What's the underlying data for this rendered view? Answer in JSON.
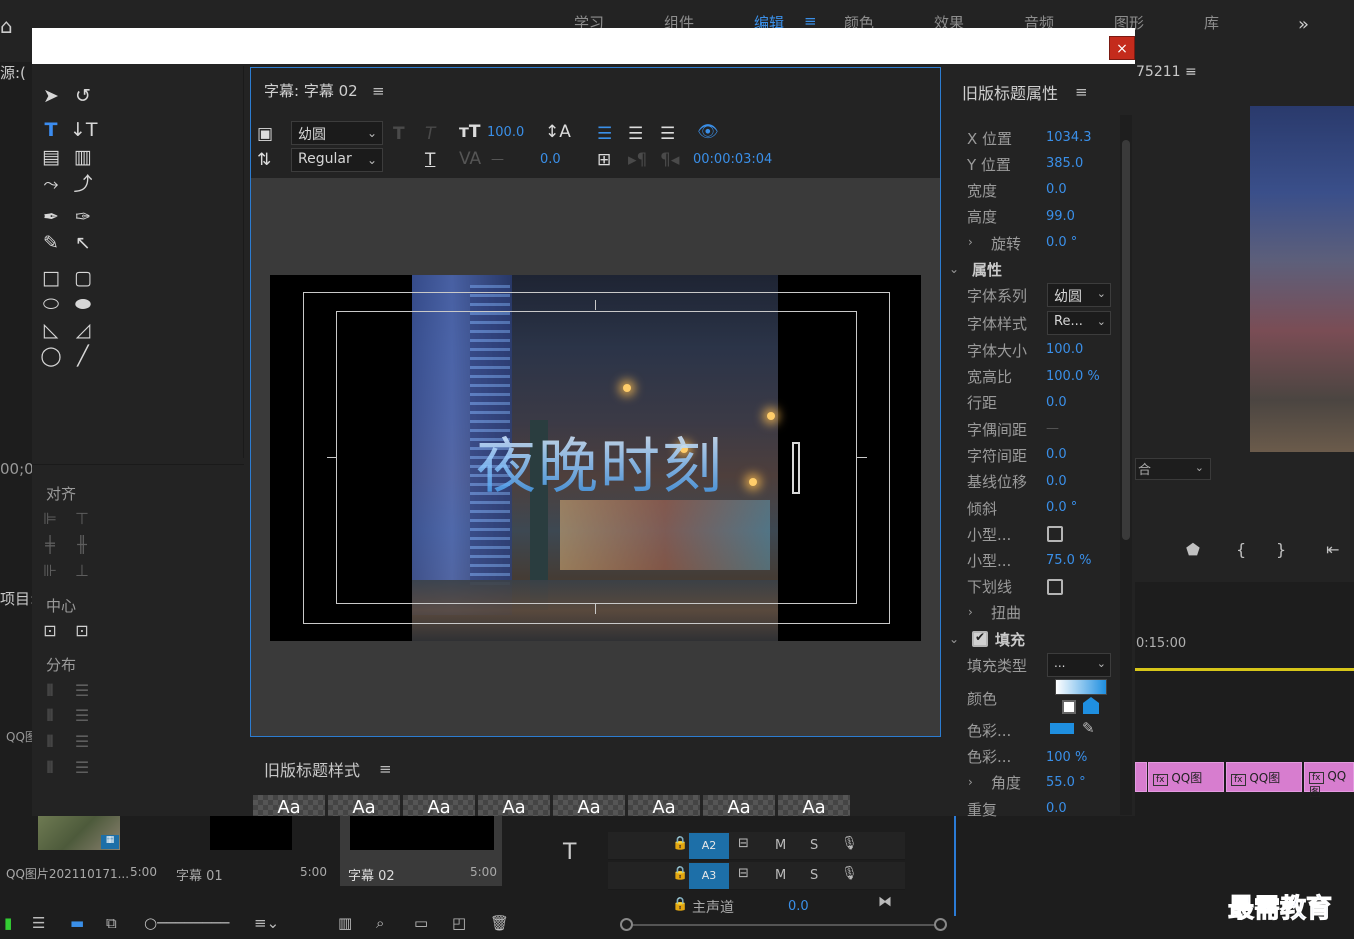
{
  "workspaces": [
    "学习",
    "组件",
    "编辑",
    "颜色",
    "效果",
    "音频",
    "图形",
    "库"
  ],
  "workspace_active": "编辑",
  "background": {
    "program_label": "75211 ≡",
    "source_label": "源:(",
    "timecode_partial": "00;0",
    "project_label": "项目:",
    "fit_select": "合",
    "timeline_time": "0:15:00",
    "clip_label": "QQ图",
    "bins": [
      {
        "name": "QQ图片202110171...",
        "duration": "5:00"
      },
      {
        "name": "字幕 01",
        "duration": "5:00"
      },
      {
        "name": "字幕 02",
        "duration": "5:00"
      }
    ],
    "tracks": [
      {
        "name": "A2",
        "m": "M",
        "s": "S"
      },
      {
        "name": "A3",
        "m": "M",
        "s": "S"
      }
    ],
    "master_label": "主声道",
    "master_value": "0.0",
    "qq_left": "QQ图",
    "watermark": "最需教育"
  },
  "modal": {
    "close": "×"
  },
  "align_panel": {
    "align_label": "对齐",
    "center_label": "中心",
    "distribute_label": "分布"
  },
  "title_panel": {
    "title": "字幕: 字幕 02",
    "font_family": "幼圆",
    "font_style": "Regular",
    "font_size": "100.0",
    "kerning": "0.0",
    "leading": "—",
    "timecode": "00:00:03:04",
    "text": "夜晚时刻"
  },
  "styles_panel": {
    "title": "旧版标题样式",
    "swatch_text": "Aa"
  },
  "properties": {
    "title": "旧版标题属性",
    "rows": {
      "x_label": "X 位置",
      "x_val": "1034.3",
      "y_label": "Y 位置",
      "y_val": "385.0",
      "w_label": "宽度",
      "w_val": "0.0",
      "h_label": "高度",
      "h_val": "99.0",
      "rot_label": "旋转",
      "rot_val": "0.0 °",
      "attr_label": "属性",
      "family_label": "字体系列",
      "family_val": "幼圆",
      "style_label": "字体样式",
      "style_val": "Re...",
      "size_label": "字体大小",
      "size_val": "100.0",
      "aspect_label": "宽高比",
      "aspect_val": "100.0 %",
      "leading_label": "行距",
      "leading_val": "0.0",
      "kern_label": "字偶间距",
      "kern_val": "—",
      "track_label": "字符间距",
      "track_val": "0.0",
      "baseline_label": "基线位移",
      "baseline_val": "0.0",
      "slant_label": "倾斜",
      "slant_val": "0.0 °",
      "smallcaps_label": "小型...",
      "smallcaps_size_label": "小型...",
      "smallcaps_size_val": "75.0 %",
      "underline_label": "下划线",
      "distort_label": "扭曲",
      "fill_label": "填充",
      "filltype_label": "填充类型",
      "filltype_val": "...",
      "color_label": "颜色",
      "colorstop1_label": "色彩...",
      "colorstop2_label": "色彩...",
      "colorstop2_val": "100 %",
      "angle_label": "角度",
      "angle_val": "55.0 °",
      "repeat_label": "重复",
      "repeat_val": "0.0"
    }
  },
  "colors": {
    "accent": "#3a8fe8",
    "panel": "#232323",
    "close": "#c42b1c",
    "clip": "#d77dcf",
    "timeline_bar": "#d7c619"
  }
}
